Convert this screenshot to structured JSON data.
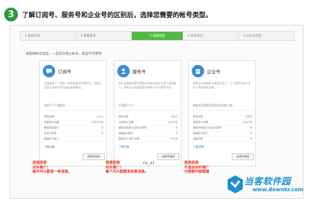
{
  "header": {
    "step_number": "3",
    "title": "了解订阅号、服务号和企业号的区别后，选择您需要的帐号类型。"
  },
  "steps": [
    {
      "label": "1 基本信息",
      "active": false
    },
    {
      "label": "2 邮箱激活",
      "active": false
    },
    {
      "label": "3 选择类型",
      "active": true
    },
    {
      "label": "4 信息登记",
      "active": false
    },
    {
      "label": "5 公众号信息",
      "active": false
    }
  ],
  "instruction": "请选择帐号类型，一旦成功建立帐号，类型不可更改",
  "cards": [
    {
      "id": "subscription",
      "title": "订阅号",
      "icon": "speech-bubble-icon",
      "description": "为媒体和个人提供一种新的信息传播方式，构建与读者之间更好的沟通与管理模式。",
      "fit": "适用于个人和组织",
      "features": [
        {
          "name": "群发消息",
          "value": "1条/天"
        },
        {
          "name": "消息显示位置",
          "value": "订阅号列表"
        },
        {
          "name": "基础消息接口",
          "value": "有"
        },
        {
          "name": "自定义菜单",
          "value": "有"
        },
        {
          "name": "高级接口能力",
          "value": ""
        }
      ],
      "more": "了解详情",
      "button": "选择并继续"
    },
    {
      "id": "service",
      "title": "服务号",
      "icon": "person-icon",
      "description": "给企业和组织提供更强大的业务服务与用户管理能力，帮助企业快速实现全新的公众号服务平台。",
      "fit": "不适用于个人",
      "features": [
        {
          "name": "群发消息",
          "value": "4条/月"
        },
        {
          "name": "消息显示位置",
          "value": "会话列表"
        },
        {
          "name": "基础消息接口/自定义菜单",
          "value": "有"
        },
        {
          "name": "高级接口能力",
          "value": "有"
        },
        {
          "name": "微信支付-商户功能",
          "value": "可申请"
        }
      ],
      "more": "了解详情",
      "button": "选择并继续"
    },
    {
      "id": "enterprise",
      "title": "企业号",
      "icon": "building-icon",
      "description": "帮助企业和组织内部建立员工、上下游供应链与企业IT系统间的连接。",
      "fit": "粉丝关注需验证身份且关注有上限",
      "features": [
        {
          "name": "群发消息",
          "value": "无限制"
        },
        {
          "name": "消息显示位置",
          "value": "会话列表"
        },
        {
          "name": "基础消息接口/自定义菜单",
          "value": "有"
        },
        {
          "name": "高级接口能力",
          "value": "有"
        },
        {
          "name": "保密消息",
          "value": "有"
        }
      ],
      "more": "了解详情",
      "button": "选择并继续"
    }
  ],
  "annotations": {
    "subscription": [
      "选我选我",
      "对外推广！",
      "每天可以群发一条消息。"
    ],
    "service": [
      "选我选我",
      "对外推广！",
      "每个月只能群发四条消息。"
    ],
    "enterprise": [
      "选我选我",
      "不适合对外推广",
      "只能做内部管理"
    ],
    "face": "(ಠ_ಠ)"
  },
  "watermark": {
    "name": "当客软件园",
    "url": "www.downkr.com"
  },
  "colors": {
    "accent_green": "#54b848",
    "badge_green": "#2b9a3c",
    "icon_blue": "#3a8fd6",
    "annotation_red": "#e8321f",
    "watermark_blue": "#1c8fd6"
  }
}
